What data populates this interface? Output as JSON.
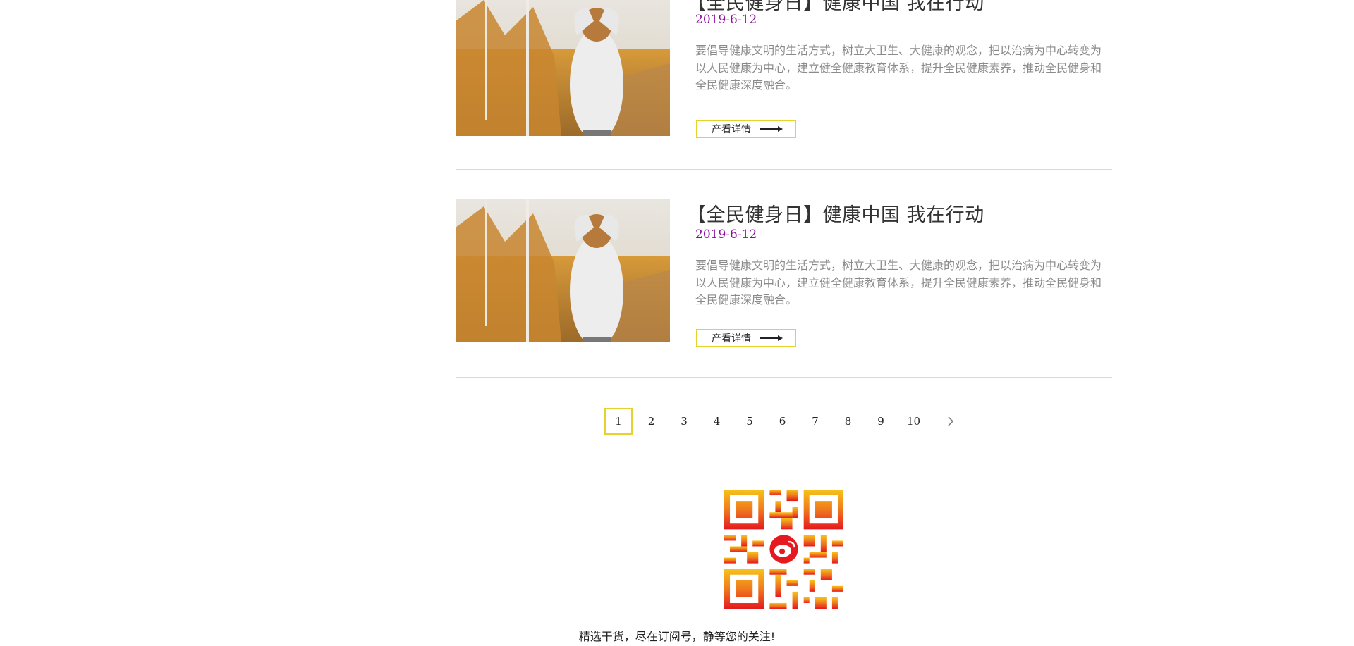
{
  "articles": [
    {
      "title": "【全民健身日】健康中国 我在行动",
      "date": "2019-6-12",
      "excerpt": "要倡导健康文明的生活方式，树立大卫生、大健康的观念，把以治病为中心转变为以人民健康为中心，建立健全健康教育体系，提升全民健康素养，推动全民健身和全民健康深度融合。",
      "button_label": "产看详情"
    },
    {
      "title": "【全民健身日】健康中国 我在行动",
      "date": "2019-6-12",
      "excerpt": "要倡导健康文明的生活方式，树立大卫生、大健康的观念，把以治病为中心转变为以人民健康为中心，建立健全健康教育体系，提升全民健康素养，推动全民健身和全民健康深度融合。",
      "button_label": "产看详情"
    }
  ],
  "pagination": {
    "pages": [
      "1",
      "2",
      "3",
      "4",
      "5",
      "6",
      "7",
      "8",
      "9",
      "10"
    ],
    "current": "1",
    "next_icon": "chevron-right-icon"
  },
  "footer": {
    "qr_icon": "weibo-qr-code",
    "follow_text": "精选干货，尽在订阅号，静等您的关注!"
  },
  "colors": {
    "accent_border": "#e6d22a",
    "date": "#8b0b9c",
    "excerpt": "#8a8a8a"
  }
}
